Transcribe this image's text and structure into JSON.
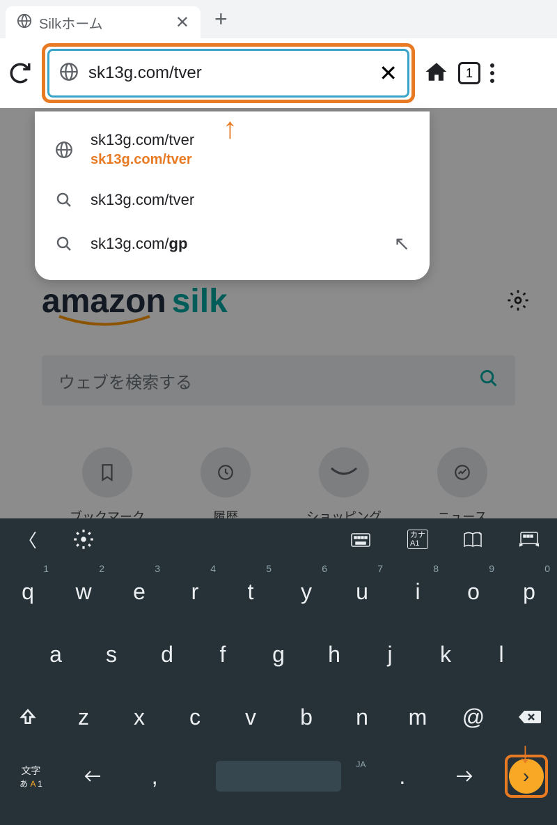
{
  "tab": {
    "title": "Silkホーム"
  },
  "url": {
    "value": "sk13g.com/tver",
    "tabs_count": "1"
  },
  "suggestions": [
    {
      "type": "url",
      "line1": "sk13g.com/tver",
      "line2": "sk13g.com/tver"
    },
    {
      "type": "search",
      "line1": "sk13g.com/tver"
    },
    {
      "type": "search",
      "line1_prefix": "sk13g.com/",
      "line1_bold": "gp"
    }
  ],
  "silk": {
    "logo1": "amazon",
    "logo2": "silk",
    "search_placeholder": "ウェブを検索する",
    "shortcuts": [
      {
        "icon": "bookmark",
        "label": "ブックマーク"
      },
      {
        "icon": "history",
        "label": "履歴"
      },
      {
        "icon": "smile",
        "label": "ショッピング"
      },
      {
        "icon": "trend",
        "label": "ニュース"
      }
    ]
  },
  "keyboard": {
    "row1": [
      {
        "k": "q",
        "n": "1"
      },
      {
        "k": "w",
        "n": "2"
      },
      {
        "k": "e",
        "n": "3"
      },
      {
        "k": "r",
        "n": "4"
      },
      {
        "k": "t",
        "n": "5"
      },
      {
        "k": "y",
        "n": "6"
      },
      {
        "k": "u",
        "n": "7"
      },
      {
        "k": "i",
        "n": "8"
      },
      {
        "k": "o",
        "n": "9"
      },
      {
        "k": "p",
        "n": "0"
      }
    ],
    "row2": [
      "a",
      "s",
      "d",
      "f",
      "g",
      "h",
      "j",
      "k",
      "l"
    ],
    "row3": [
      "z",
      "x",
      "c",
      "v",
      "b",
      "n",
      "m",
      "@"
    ],
    "moji": "文字",
    "moji_sub_a": "あ",
    "moji_sub_b": "A",
    "moji_sub_c": "1",
    "comma": ",",
    "period": ".",
    "ja": "JA"
  }
}
